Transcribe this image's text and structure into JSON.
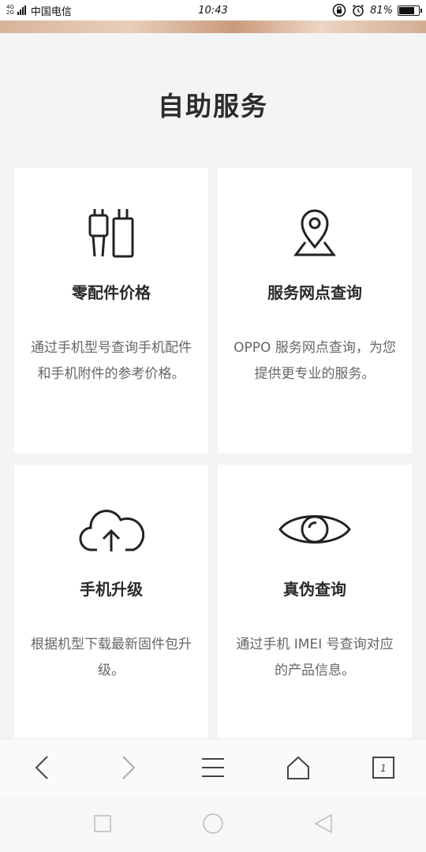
{
  "status_bar": {
    "network_top": "4G",
    "network_bottom": "2G",
    "carrier": "中国电信",
    "time": "10:43",
    "battery": "81%",
    "battery_level": 0.81
  },
  "section": {
    "title": "自助服务"
  },
  "cards": [
    {
      "title": "零配件价格",
      "description": "通过手机型号查询手机配件和手机附件的参考价格。",
      "icon": "charger-cable-icon"
    },
    {
      "title": "服务网点查询",
      "description": "OPPO 服务网点查询，为您提供更专业的服务。",
      "icon": "location-pin-map-icon"
    },
    {
      "title": "手机升级",
      "description": "根据机型下载最新固件包升级。",
      "icon": "cloud-upload-icon"
    },
    {
      "title": "真伪查询",
      "description": "通过手机 IMEI 号查询对应的产品信息。",
      "icon": "eye-icon"
    }
  ],
  "browser_nav": {
    "tab_count": "1",
    "items": [
      "back-arrow-icon",
      "forward-arrow-icon",
      "menu-icon",
      "home-icon",
      "tabs-icon"
    ]
  },
  "system_nav": {
    "items": [
      "recent-apps-icon",
      "home-circle-icon",
      "back-triangle-icon"
    ]
  }
}
